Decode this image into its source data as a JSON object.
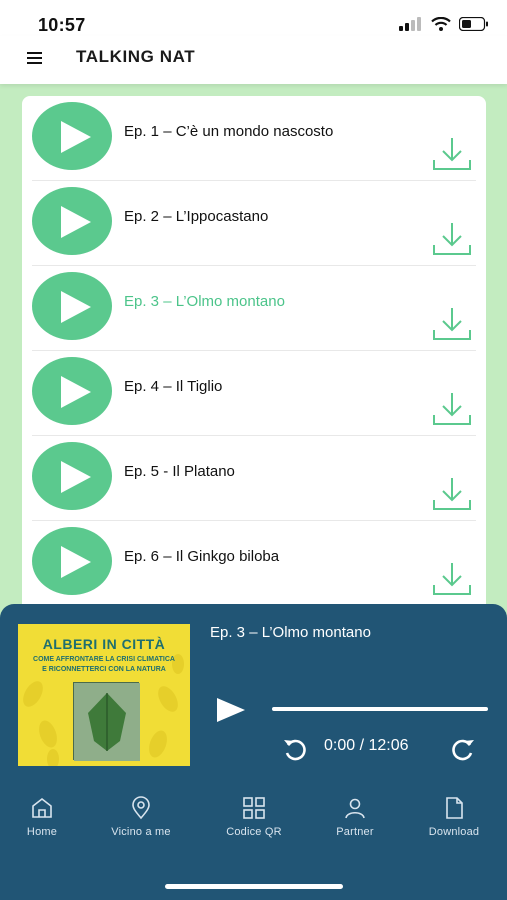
{
  "status_bar": {
    "time": "10:57"
  },
  "header": {
    "title": "TALKING NAT"
  },
  "episodes": [
    {
      "title": "Ep. 1 – C’è un mondo nascosto",
      "active": false
    },
    {
      "title": "Ep. 2 – L’Ippocastano",
      "active": false
    },
    {
      "title": "Ep. 3 – L’Olmo montano",
      "active": true
    },
    {
      "title": "Ep. 4 – Il Tiglio",
      "active": false
    },
    {
      "title": "Ep. 5 - Il Platano",
      "active": false
    },
    {
      "title": "Ep. 6 – Il Ginkgo biloba",
      "active": false
    }
  ],
  "player": {
    "track_title": "Ep. 3 – L’Olmo montano",
    "cover_title": "ALBERI IN CITTÀ",
    "cover_subtitle_1": "COME AFFRONTARE LA CRISI CLIMATICA",
    "cover_subtitle_2": "E RICONNETTERCI CON LA NATURA",
    "time_readout": "0:00 / 12:06",
    "progress": 0
  },
  "nav": [
    {
      "label": "Home",
      "icon": "home-icon"
    },
    {
      "label": "Vicino a me",
      "icon": "location-pin-icon"
    },
    {
      "label": "Codice QR",
      "icon": "qr-grid-icon"
    },
    {
      "label": "Partner",
      "icon": "person-icon"
    },
    {
      "label": "Download",
      "icon": "file-icon"
    }
  ],
  "colors": {
    "accent_green": "#5bc98e",
    "active_text": "#4cc48a",
    "list_background": "#c3ecc0",
    "player_background": "#215575"
  }
}
